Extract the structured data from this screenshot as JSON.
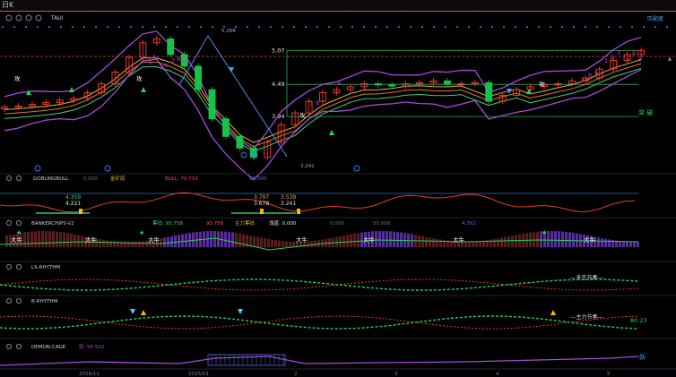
{
  "window": {
    "title": "日K"
  },
  "main": {
    "indicator_name": "TAUI",
    "top_right_label": "匹配度",
    "price_labels": [
      "5.07",
      "4.49",
      "3.94"
    ],
    "high_marker": "5.268",
    "low_marker": "3.241",
    "mini_labels": [
      "攻",
      "攻",
      "攻",
      "攻"
    ],
    "seq_numbers": [
      "3",
      "4",
      "5",
      "6",
      "7",
      "8",
      "9",
      "7",
      "8",
      "9",
      "7",
      "8",
      "9",
      "1",
      "2",
      "3",
      "7",
      "8",
      "9"
    ],
    "right_label": "突 破",
    "circle_markers": [
      "C",
      "C",
      "C",
      "C",
      "C"
    ]
  },
  "panels": [
    {
      "name": "GOBLINGBULL",
      "items": [
        "GOBLINGBULL",
        "5.000",
        "金矿底",
        "BULL: 70.733",
        "55.000"
      ],
      "values": [
        "4.359",
        "4.221",
        "3.797",
        "3.678",
        "3.539",
        "3.241"
      ]
    },
    {
      "name": "BANKERCHIPS-V2",
      "items": [
        "BANKERCHIPS-V2",
        "筹码: 93.758",
        "93.758",
        "主力筹码",
        "浅蓝: 0.000",
        "0.000",
        "50.000",
        "4.762"
      ],
      "labels": [
        "大牛",
        "大牛",
        "大牛",
        "大牛",
        "大牛",
        "大牛",
        "大牛"
      ]
    },
    {
      "name": "LS-RHYTHM",
      "items": [
        "LS-RHYTHM"
      ],
      "note": "多空节奏"
    },
    {
      "name": "B-RHYTHM",
      "items": [
        "B-RHYTHM"
      ],
      "note": "主力节奏",
      "value": "80.23"
    },
    {
      "name": "DEMON-CAGE",
      "items": [
        "DEMON-CAGE",
        "妖: 95.502"
      ],
      "right_label": "妖"
    }
  ],
  "x_axis": [
    "2024/12",
    "2025/01",
    "2",
    "3",
    "4",
    "5"
  ],
  "colors": {
    "up": "#ff3b30",
    "down": "#16c24a",
    "bg": "#000000"
  },
  "chart_data": {
    "type": "candlestick",
    "title": "",
    "x": [
      "2024/12",
      "2025/01",
      "2",
      "3",
      "4",
      "5"
    ],
    "ylim": [
      3.1,
      5.35
    ],
    "series": [
      {
        "values": [
          4.1,
          4.12,
          4.15,
          4.18,
          4.22,
          4.25,
          4.35,
          4.5,
          4.7,
          4.95,
          5.2,
          5.268,
          5.0,
          4.8,
          4.4,
          3.9,
          3.6,
          3.4,
          3.241,
          3.5,
          3.8,
          4.0,
          4.2,
          4.35,
          4.4,
          4.45,
          4.5,
          4.48,
          4.46,
          4.5,
          4.52,
          4.55,
          4.49,
          4.5,
          4.52,
          4.2,
          4.3,
          4.4,
          4.45,
          4.48,
          4.5,
          4.55,
          4.6,
          4.75,
          4.9,
          5.0,
          5.07
        ]
      }
    ]
  }
}
